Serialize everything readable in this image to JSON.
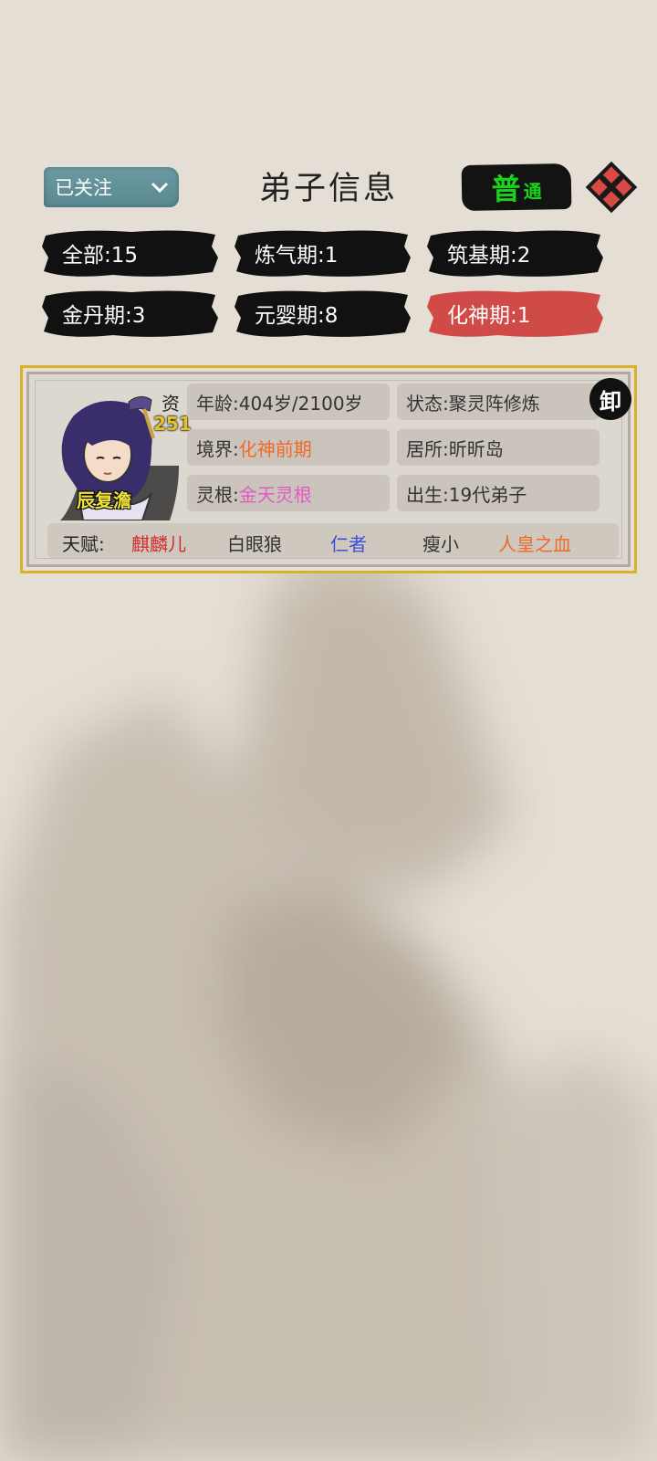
{
  "header": {
    "filter_dropdown": "已关注",
    "title": "弟子信息",
    "mode_big": "普",
    "mode_small": "通"
  },
  "tabs": [
    {
      "label": "全部:15",
      "color": "#111111"
    },
    {
      "label": "炼气期:1",
      "color": "#111111"
    },
    {
      "label": "筑基期:2",
      "color": "#111111"
    },
    {
      "label": "金丹期:3",
      "color": "#111111"
    },
    {
      "label": "元婴期:8",
      "color": "#111111"
    },
    {
      "label": "化神期:1",
      "color": "#d04a47",
      "selected": true
    }
  ],
  "disciple": {
    "aptitude_label": "资",
    "aptitude_value": "251",
    "name": "辰复澹",
    "age_label": "年龄:",
    "age_value": "404岁/2100岁",
    "status_label": "状态:",
    "status_value": "聚灵阵修炼",
    "realm_label": "境界:",
    "realm_value": "化神前期",
    "residence_label": "居所:",
    "residence_value": "昕昕岛",
    "root_label": "灵根:",
    "root_value": "金天灵根",
    "birth_label": "出生:",
    "birth_value": "19代弟子",
    "resign_seal": "卸",
    "talents_label": "天赋:",
    "talents": [
      {
        "name": "麒麟儿",
        "color": "#d42b2b"
      },
      {
        "name": "白眼狼",
        "color": "#333333"
      },
      {
        "name": "仁者",
        "color": "#3b4fd8"
      },
      {
        "name": "瘦小",
        "color": "#333333"
      },
      {
        "name": "人皇之血",
        "color": "#ef6a2a"
      }
    ]
  },
  "colors": {
    "realm": "#ef6a2a",
    "root": "#e25ac4",
    "frame_gold": "#d8b12a"
  }
}
